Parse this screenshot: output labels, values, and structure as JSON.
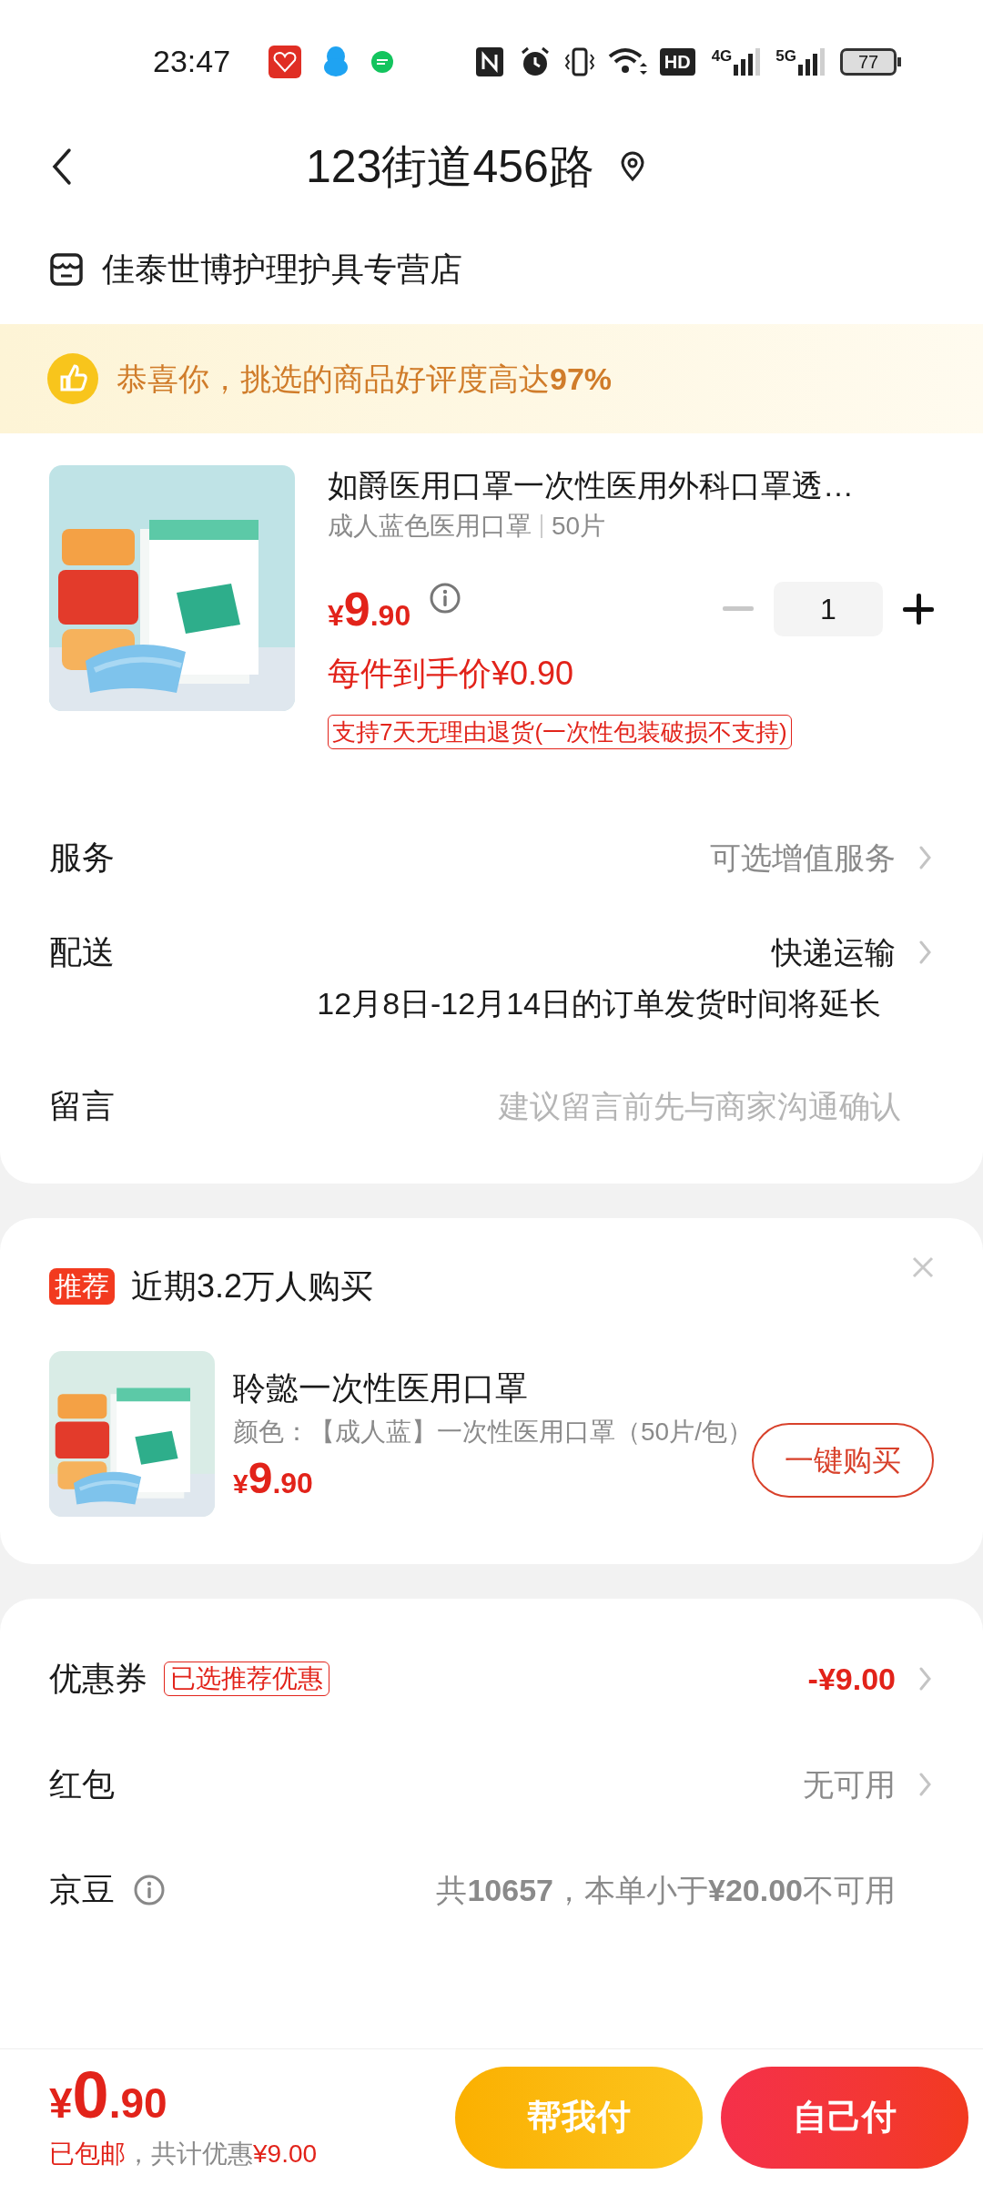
{
  "status_bar": {
    "time": "23:47",
    "hd": "HD",
    "networks": [
      "4G",
      "5G"
    ],
    "battery": "77"
  },
  "header": {
    "title": "123街道456路"
  },
  "store": {
    "name": "佳泰世博护理护具专营店"
  },
  "banner": {
    "text": "恭喜你，挑选的商品好评度高达**97%**"
  },
  "product": {
    "kind": "picture",
    "title": "如爵医用口罩一次性医用外科口罩透…",
    "spec": "成人蓝色医用口罩",
    "count": "50片",
    "currency": "¥",
    "price_int": "9",
    "price_dec": ".90",
    "unit_price": "每件到手价¥0.90",
    "quantity": "1",
    "minus_disabled": true,
    "policy": "支持7天无理由退货(一次性包装破损不支持)"
  },
  "options": [
    {
      "kind": "link",
      "label": "服务",
      "value": "可选增值服务",
      "muted": true
    },
    {
      "kind": "link",
      "label": "配送",
      "value": "快递运输",
      "muted": false,
      "note": "12月8日-12月14日的订单发货时间将延长"
    },
    {
      "kind": "input",
      "label": "留言",
      "placeholder": "建议留言前先与商家沟通确认"
    }
  ],
  "recommend": {
    "tag": "推荐",
    "title": "近期3.2万人购买",
    "item": {
      "kind": "picture",
      "name": "聆懿一次性医用口罩",
      "spec": "颜色：【成人蓝】一次性医用口罩（50片/包）",
      "currency": "¥",
      "price_int": "9",
      "price_dec": ".90",
      "button": "一键购买"
    }
  },
  "discounts": [
    {
      "label": "优惠券",
      "tag": "已选推荐优惠",
      "value": "-¥9.00",
      "highlight": true,
      "info": false,
      "arrow": true
    },
    {
      "label": "红包",
      "value": "无可用",
      "highlight": false,
      "info": false,
      "arrow": true
    },
    {
      "label": "京豆",
      "value": "共**10657**，本单小于**¥20.00**不可用",
      "highlight": false,
      "info": true,
      "arrow": false
    }
  ],
  "footer": {
    "currency": "¥",
    "price_int": "0",
    "price_dec": ".90",
    "shipping": "已包邮",
    "saving_label": "，共计优惠",
    "saving": "¥9.00",
    "buttons": [
      {
        "label": "帮我付",
        "kind": "helper"
      },
      {
        "label": "自己付",
        "kind": "pay"
      }
    ]
  }
}
